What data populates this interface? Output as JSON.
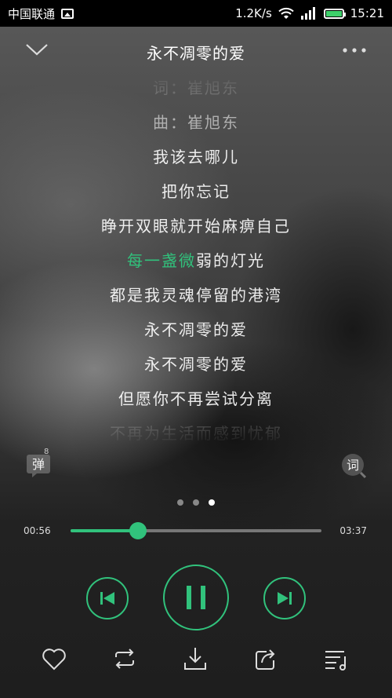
{
  "status_bar": {
    "carrier": "中国联通",
    "speed": "1.2K/s",
    "time": "15:21"
  },
  "header": {
    "title": "永不凋零的爱"
  },
  "lyrics": [
    {
      "text": "词：崔旭东",
      "state": "faded"
    },
    {
      "text": "曲：崔旭东",
      "state": "normal"
    },
    {
      "text": "我该去哪儿",
      "state": "normal"
    },
    {
      "text": "把你忘记",
      "state": "normal"
    },
    {
      "text": "睁开双眼就开始麻痹自己",
      "state": "normal"
    },
    {
      "text_highlight": "每一盏微",
      "text_rest": "弱的灯光",
      "state": "current"
    },
    {
      "text": "都是我灵魂停留的港湾",
      "state": "normal"
    },
    {
      "text": "永不凋零的爱",
      "state": "normal"
    },
    {
      "text": "永不凋零的爱",
      "state": "normal"
    },
    {
      "text": "但愿你不再尝试分离",
      "state": "normal"
    },
    {
      "text": "不再为生活而感到忧郁",
      "state": "faded"
    }
  ],
  "side_buttons": {
    "danmu_label": "弹",
    "danmu_count": "8",
    "lyric_label": "词"
  },
  "pager": {
    "total": 3,
    "active": 3
  },
  "player": {
    "current_time": "00:56",
    "total_time": "03:37",
    "progress": 0.27,
    "state": "playing"
  },
  "colors": {
    "accent": "#31c27c",
    "background": "#2b2b2b"
  },
  "icons": {
    "header": [
      "chevron-down-icon",
      "more-icon"
    ],
    "controls": [
      "prev-icon",
      "pause-icon",
      "next-icon"
    ],
    "bottom": [
      "heart-icon",
      "repeat-icon",
      "download-icon",
      "share-icon",
      "playlist-icon"
    ]
  }
}
